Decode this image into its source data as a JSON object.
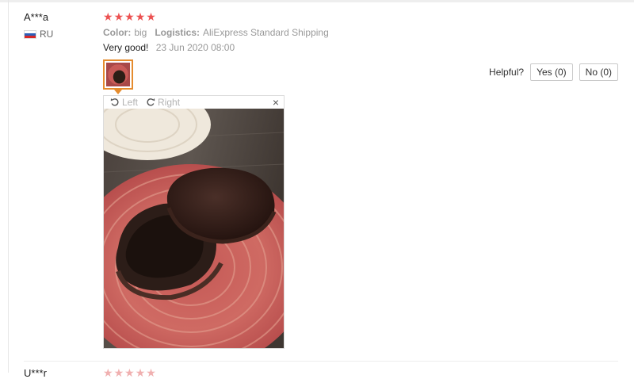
{
  "review": {
    "user": "A***a",
    "country": "RU",
    "rating": 5,
    "attributes": [
      {
        "name": "Color:",
        "value": "big"
      },
      {
        "name": "Logistics:",
        "value": "AliExpress Standard Shipping"
      }
    ],
    "text": "Very good!",
    "date": "23 Jun 2020 08:00"
  },
  "helpful": {
    "label": "Helpful?",
    "yes": "Yes (0)",
    "no": "No (0)"
  },
  "viewer": {
    "rotate_left": "Left",
    "rotate_right": "Right",
    "close": "×",
    "icons": [
      "rotate-left-icon",
      "rotate-right-icon",
      "close-icon"
    ]
  },
  "next_review": {
    "user": "U***r"
  },
  "colors": {
    "star": "#ec5151",
    "thumb_border": "#e58c2e"
  }
}
